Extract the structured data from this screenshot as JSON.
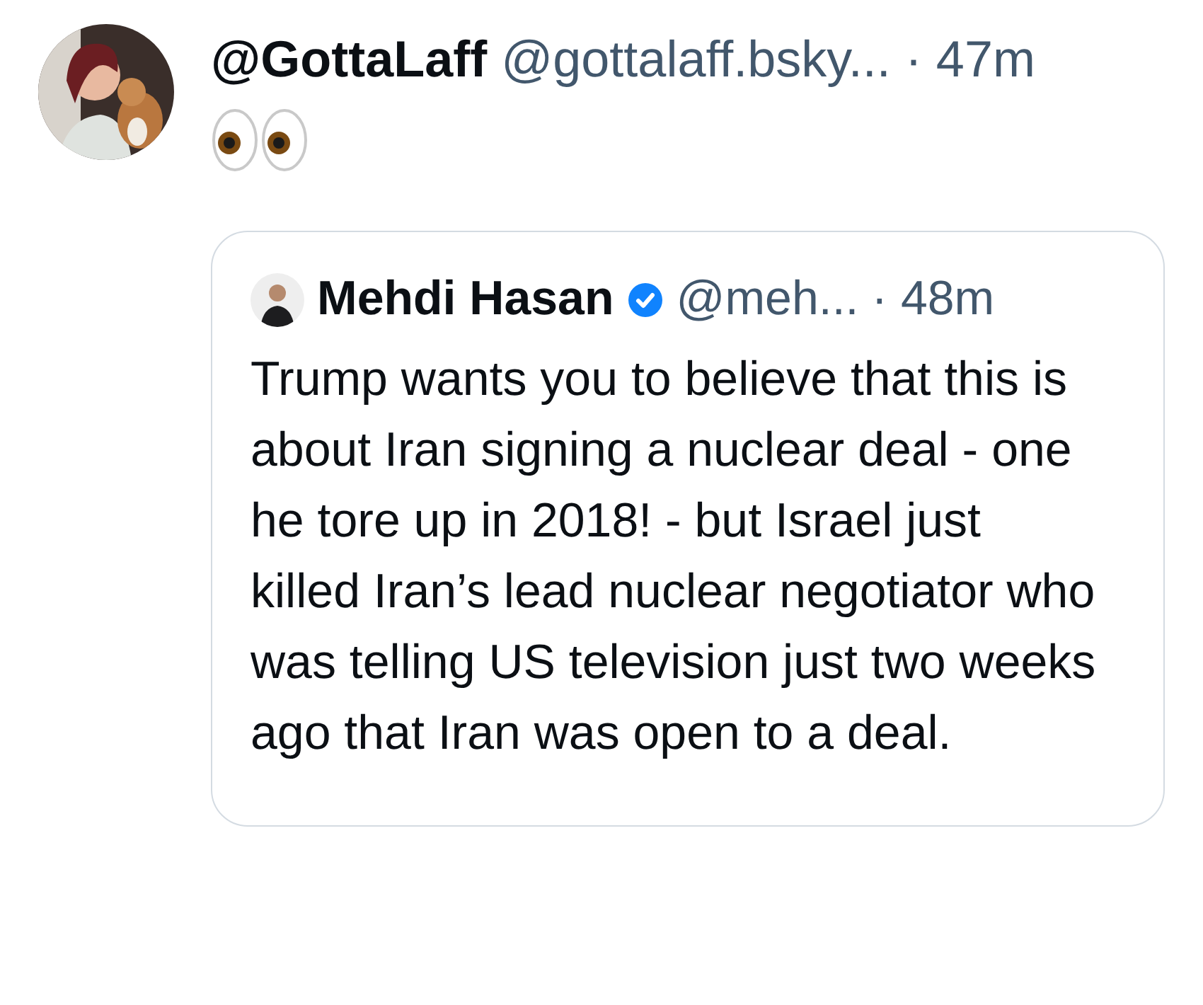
{
  "post": {
    "display_name": "@GottaLaff",
    "handle": "@gottalaff.bsky...",
    "time": "· 47m"
  },
  "quote": {
    "display_name": "Mehdi Hasan",
    "verified": true,
    "handle": "@meh...",
    "time": "· 48m",
    "text": "Trump wants you to believe that this is about Iran signing a nuclear deal - one he tore up in 2018! - but Israel just killed Iran’s lead nuclear negotiator who was telling US television just two weeks ago that Iran was open to a deal."
  }
}
